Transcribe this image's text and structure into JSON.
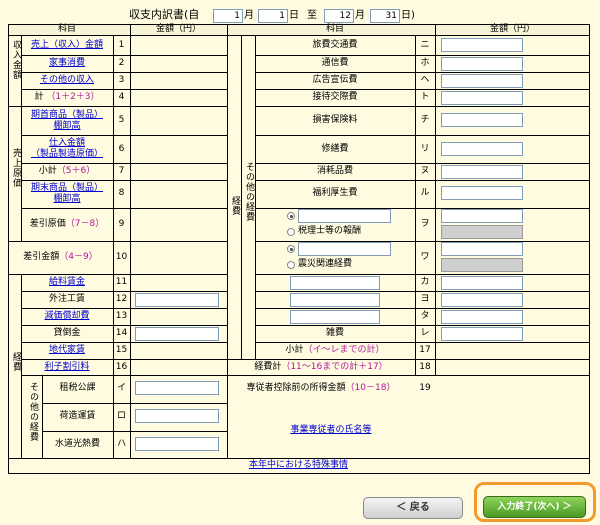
{
  "title": {
    "heading": "収支内訳書",
    "from_paren": "(自",
    "from_month": "1",
    "month_unit": "月",
    "from_day": "1",
    "day_unit": "日",
    "to_label": "至",
    "to_month": "12",
    "to_month_unit": "月",
    "to_day": "31",
    "to_day_unit": "日)"
  },
  "headers": {
    "item": "科目",
    "amount": "金額（円）",
    "item2": "科目",
    "amount2": "金額（円）"
  },
  "left_groups": {
    "income": "収入金額",
    "cogs": "売上原価",
    "expenses": "経費",
    "other_exp": "その他の経費",
    "mid_expenses": "経費",
    "mid_other": "その他の経費"
  },
  "left_rows": [
    {
      "label": "売上（収入）金額",
      "no": "1"
    },
    {
      "label": "家事消費",
      "no": "2"
    },
    {
      "label": "その他の収入",
      "no": "3"
    },
    {
      "label": "計",
      "calc": "（1＋2＋3）",
      "no": "4"
    },
    {
      "label": "期首商品（製品）",
      "label2": "棚卸高",
      "no": "5"
    },
    {
      "label": "仕入金額",
      "label2": "（製品製造原価）",
      "no": "6"
    },
    {
      "label": "小計",
      "calc": "（5＋6）",
      "no": "7"
    },
    {
      "label": "期末商品（製品）",
      "label2": "棚卸高",
      "no": "8"
    },
    {
      "label": "差引原価",
      "calc": "（7－8）",
      "no": "9"
    },
    {
      "label": "差引金額",
      "calc": "（4－9）",
      "no": "10"
    },
    {
      "label": "給料賃金",
      "no": "11"
    },
    {
      "label": "外注工賃",
      "no": "12"
    },
    {
      "label": "減価償却費",
      "no": "13"
    },
    {
      "label": "貸倒金",
      "no": "14"
    },
    {
      "label": "地代家賃",
      "no": "15"
    },
    {
      "label": "利子割引料",
      "no": "16"
    },
    {
      "label": "租税公課",
      "no": "イ"
    },
    {
      "label": "荷造運賃",
      "no": "ロ"
    },
    {
      "label": "水道光熱費",
      "no": "ハ"
    }
  ],
  "right_rows": [
    {
      "label": "旅費交通費",
      "no": "ニ"
    },
    {
      "label": "通信費",
      "no": "ホ"
    },
    {
      "label": "広告宣伝費",
      "no": "ヘ"
    },
    {
      "label": "接待交際費",
      "no": "ト"
    },
    {
      "label": "損害保険料",
      "no": "チ"
    },
    {
      "label": "修繕費",
      "no": "リ"
    },
    {
      "label": "消耗品費",
      "no": "ヌ"
    },
    {
      "label": "福利厚生費",
      "no": "ル"
    },
    {
      "option": "税理士等の報酬",
      "no": "ヲ"
    },
    {
      "option": "震災関連経費",
      "no": "ワ"
    },
    {
      "no": "カ"
    },
    {
      "no": "ヨ"
    },
    {
      "no": "タ"
    },
    {
      "label": "雑費",
      "no": "レ"
    },
    {
      "label": "小計",
      "calc": "（イ～レまでの計）",
      "no": "17"
    },
    {
      "label": "経費計",
      "calc": "（11～16までの計＋17）",
      "no": "18"
    },
    {
      "label": "専従者控除前の所得金額",
      "calc": "（10－18）",
      "no": "19"
    }
  ],
  "links": {
    "employees": "事業専従者の氏名等",
    "special": "本年中における特殊事情"
  },
  "buttons": {
    "back": "＜ 戻る",
    "next": "入力終了(次へ) ＞"
  }
}
